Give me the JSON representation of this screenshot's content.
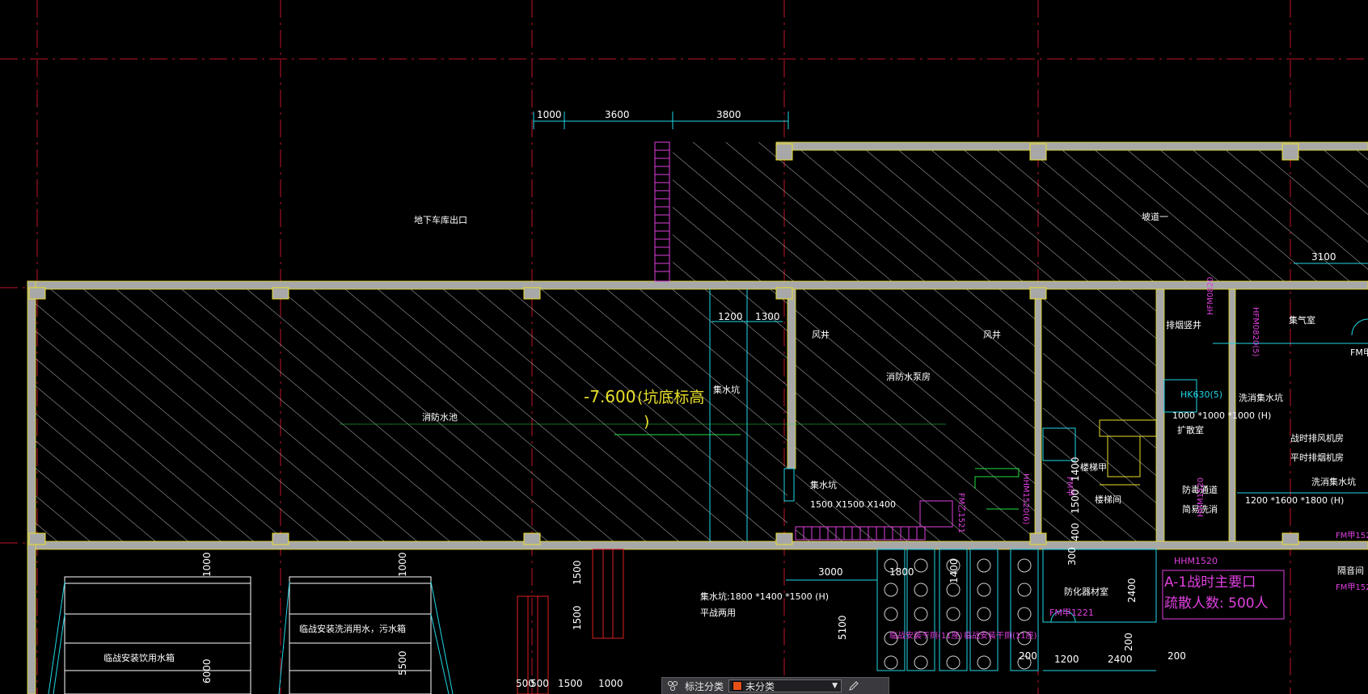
{
  "colors": {
    "background": "#000000",
    "grid_axis": "#c0142a",
    "wall": "#a0a0a0",
    "hatch": "#d8d8d8",
    "dimension_text": "#ffffff",
    "elevation_note": "#e8e02a",
    "door_tag": "#e040e0",
    "equipment": "#20d8e8",
    "exit_note": "#e040e0"
  },
  "top_dimensions": [
    "1000",
    "3600",
    "3800"
  ],
  "labels": {
    "garage_exit": "地下车库出口",
    "ramp": "坡道一",
    "fire_pool": "消防水池",
    "pump_room": "消防水泵房",
    "sump_small": "集水坑",
    "shaft_left": "风井",
    "shaft_right": "风井",
    "stair_room": "楼梯间",
    "stair_a": "楼梯甲",
    "smoke_shaft": "排烟竖井",
    "gas_room": "集气室",
    "expansion_room": "扩散室",
    "decon_channel": "防毒通道",
    "simple_wash": "简易洗消",
    "war_fan_room": "战时排风机房",
    "peace_fan_room": "平时排烟机房",
    "wash_sump_1": "洗消集水坑",
    "wash_sump_1_size": "1000 *1000 *1000 (H)",
    "wash_sump_2": "洗消集水坑",
    "wash_sump_2_size": "1200 *1600 *1800 (H)",
    "sump_main": "集水坑",
    "sump_main_size": "1500 X1500 X1400",
    "sump_lower": "集水坑:1800 *1400 *1500 (H)",
    "sump_lower_note": "平战两用",
    "chem_room": "防化器材室",
    "drink_tank": "临战安装饮用水箱",
    "wash_tank": "临战安装洗消用水，污水箱",
    "airlock": "隔音间",
    "dry_toilet_left": "临战安装干厕(11座)",
    "dry_toilet_right": "临战安装干厕(11座)"
  },
  "elevation": {
    "value": "-7.600",
    "note": "(坑底标高",
    "close": ")"
  },
  "exit_note": {
    "title": "A-1战时主要口",
    "capacity": "疏散人数: 500人"
  },
  "door_tags": [
    "HFM0820",
    "HFM0820(5)",
    "HHM1520",
    "HHM1520",
    "FM甲1221",
    "FM甲1521",
    "FM甲1521",
    "FM乙1521",
    "HK630(5)",
    "HHM1520(6)",
    "FM甲1521",
    "FM甲"
  ],
  "dimensions": {
    "d1200": "1200",
    "d1300": "1300",
    "d3100": "3100",
    "d3000": "3000",
    "d1800": "1800",
    "d1400": "1400",
    "d1500a": "1500",
    "d1500b": "1500",
    "d5100": "5100",
    "d1000a": "1000",
    "d1000b": "1000",
    "d6000": "6000",
    "d5500": "5500",
    "d500": "500",
    "d500b": "500",
    "d1500c": "1500",
    "d1000c": "1000",
    "d300": "300",
    "d2400a": "2400",
    "d200a": "200",
    "d200b": "200",
    "d200c": "200",
    "d1200b": "1200",
    "d2400b": "2400",
    "d1400b": "1400",
    "d1500d": "1500",
    "d400": "400"
  },
  "toolbar": {
    "label": "标注分类",
    "selected": "未分类",
    "icon_left": "layer-group-icon",
    "icon_right": "edit-icon"
  }
}
